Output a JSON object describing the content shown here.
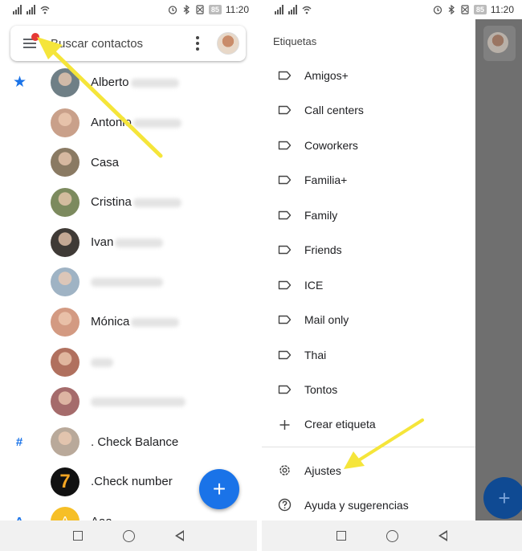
{
  "status_bar": {
    "battery": "85",
    "time": "11:20"
  },
  "left": {
    "search": {
      "placeholder": "Buscar contactos"
    },
    "contacts": [
      {
        "letter": "★",
        "name": "Alberto",
        "blur": "surname",
        "avatar_color": "#6f7f86"
      },
      {
        "letter": "",
        "name": "Antonio",
        "blur": "surname",
        "avatar_color": "#c9a08a"
      },
      {
        "letter": "",
        "name": "Casa",
        "blur": "",
        "avatar_color": "#8a7a63"
      },
      {
        "letter": "",
        "name": "Cristina",
        "blur": "surname",
        "avatar_color": "#7c8a5e"
      },
      {
        "letter": "",
        "name": "Ivan",
        "blur": "surname",
        "avatar_color": "#3f3a36"
      },
      {
        "letter": "",
        "name": "",
        "blur": "full",
        "avatar_color": "#9fb3c4"
      },
      {
        "letter": "",
        "name": "Mónica",
        "blur": "surname",
        "avatar_color": "#d39a82"
      },
      {
        "letter": "",
        "name": "",
        "blur": "full-short",
        "avatar_color": "#b0705e"
      },
      {
        "letter": "",
        "name": "",
        "blur": "full-long",
        "avatar_color": "#a56b6b"
      },
      {
        "letter": "#",
        "name": ". Check Balance",
        "blur": "",
        "avatar_color": "#b9a99a"
      },
      {
        "letter": "",
        "name": ".Check number",
        "blur": "",
        "avatar_color": "#111111"
      },
      {
        "letter": "A",
        "name": "Aaa",
        "blur": "",
        "avatar_color": "#f6bf26"
      }
    ],
    "fab_label": "+"
  },
  "right": {
    "heading": "Etiquetas",
    "labels": [
      {
        "text": "Amigos+"
      },
      {
        "text": "Call centers"
      },
      {
        "text": "Coworkers"
      },
      {
        "text": "Familia+"
      },
      {
        "text": "Family"
      },
      {
        "text": "Friends"
      },
      {
        "text": "ICE"
      },
      {
        "text": "Mail only"
      },
      {
        "text": "Thai"
      },
      {
        "text": "Tontos"
      }
    ],
    "create_label": "Crear etiqueta",
    "settings": "Ajustes",
    "help": "Ayuda y sugerencias"
  },
  "colors": {
    "accent": "#1a73e8",
    "arrow": "#f5e53a",
    "badge": "#e53935"
  }
}
